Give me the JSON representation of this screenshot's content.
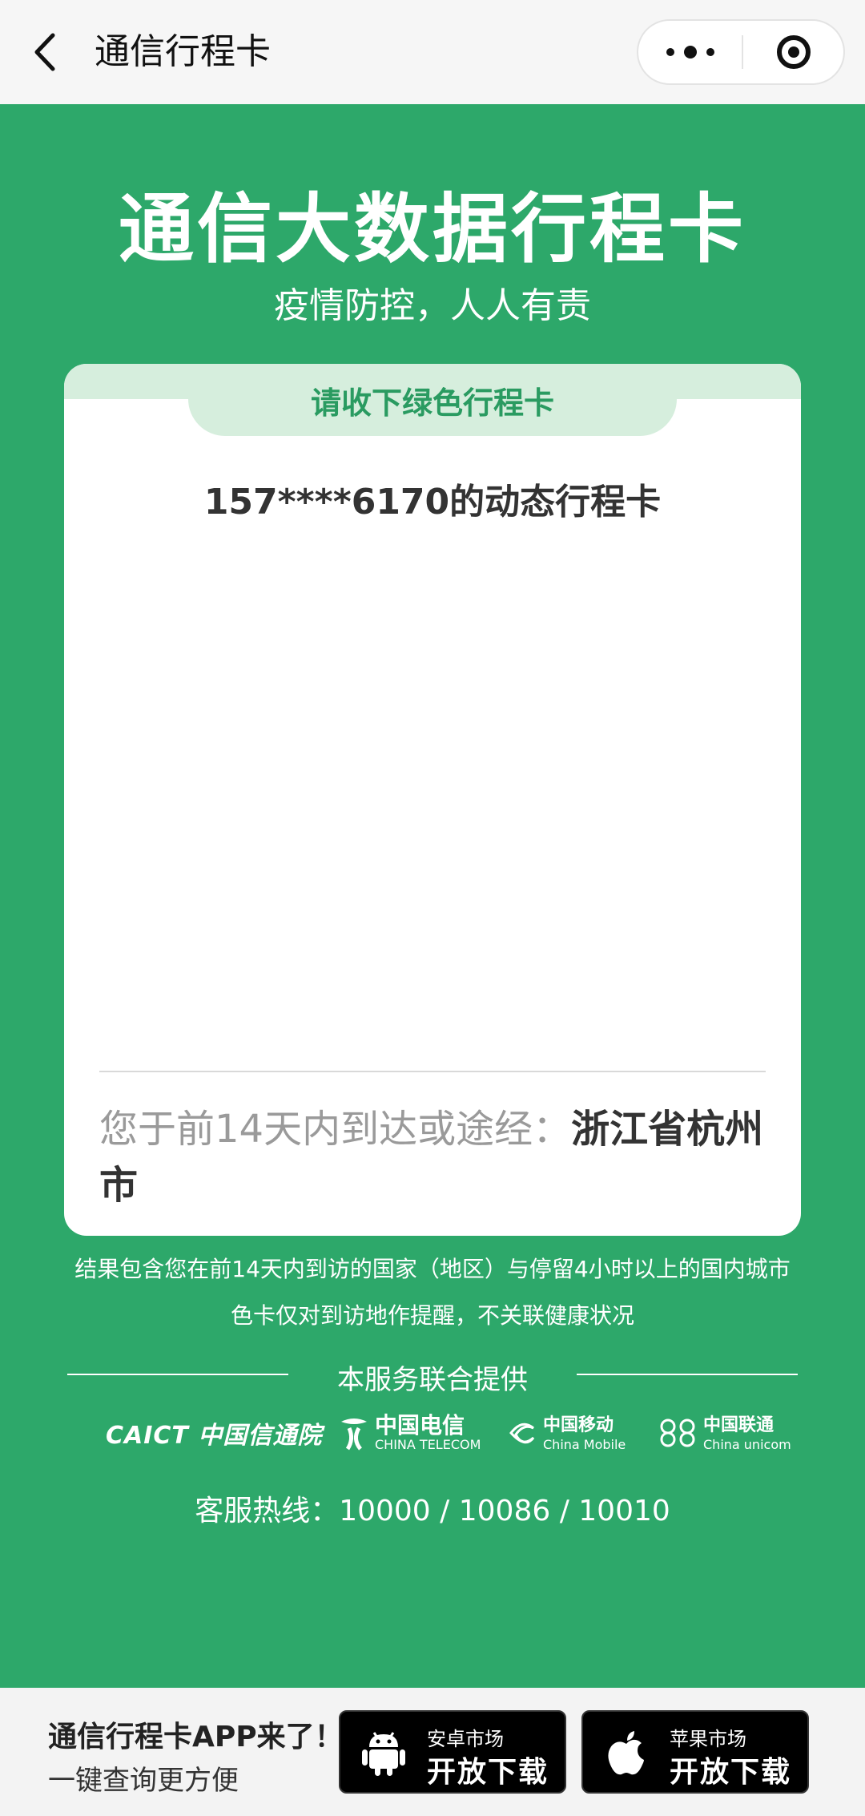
{
  "nav": {
    "title": "通信行程卡"
  },
  "header": {
    "title": "通信大数据行程卡",
    "subtitle": "疫情防控，人人有责"
  },
  "card": {
    "tab_label": "请收下绿色行程卡",
    "phone_line": "157****6170的动态行程卡",
    "visit_prefix": "您于前14天内到达或途经：",
    "visit_city": "浙江省杭州市",
    "status_color": "#2da86a"
  },
  "notes": {
    "line1": "结果包含您在前14天内到访的国家（地区）与停留4小时以上的国内城市",
    "line2": "色卡仅对到访地作提醒，不关联健康状况"
  },
  "providers": {
    "label": "本服务联合提供",
    "logos": [
      {
        "name": "CAICT 中国信通院",
        "icon": "caict-logo"
      },
      {
        "name": "中国电信",
        "sub": "CHINA TELECOM",
        "icon": "china-telecom-logo"
      },
      {
        "name": "中国移动",
        "sub": "China Mobile",
        "icon": "china-mobile-logo"
      },
      {
        "name": "中国联通",
        "sub": "China unicom",
        "icon": "china-unicom-logo"
      }
    ]
  },
  "hotline": "客服热线：10000 / 10086 / 10010",
  "promo": {
    "title": "通信行程卡APP来了！",
    "subtitle": "一键查询更方便",
    "android": {
      "small": "安卓市场",
      "big": "开放下载"
    },
    "apple": {
      "small": "苹果市场",
      "big": "开放下载"
    }
  }
}
